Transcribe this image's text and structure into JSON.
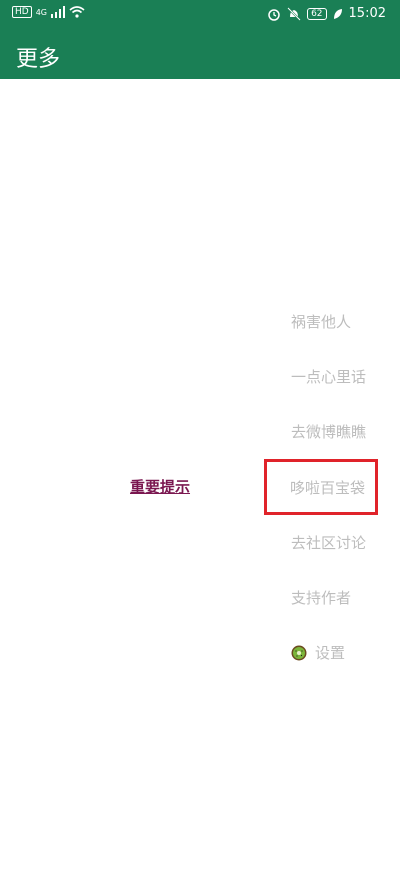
{
  "status_bar": {
    "network_badge": "HD",
    "signal_label": "4G",
    "battery": "62",
    "time": "15:02"
  },
  "app_bar": {
    "title": "更多"
  },
  "content": {
    "notice_link": "重要提示",
    "menu": [
      {
        "label": "祸害他人"
      },
      {
        "label": "一点心里话"
      },
      {
        "label": "去微博瞧瞧"
      },
      {
        "label": "哆啦百宝袋",
        "highlighted": true
      },
      {
        "label": "去社区讨论"
      },
      {
        "label": "支持作者"
      },
      {
        "label": "设置",
        "icon": "kiwi-icon"
      }
    ]
  },
  "colors": {
    "primary": "#1a7f55",
    "highlight_border": "#e0232a",
    "notice_text": "#7a1750",
    "menu_text": "#bdbdbd"
  }
}
